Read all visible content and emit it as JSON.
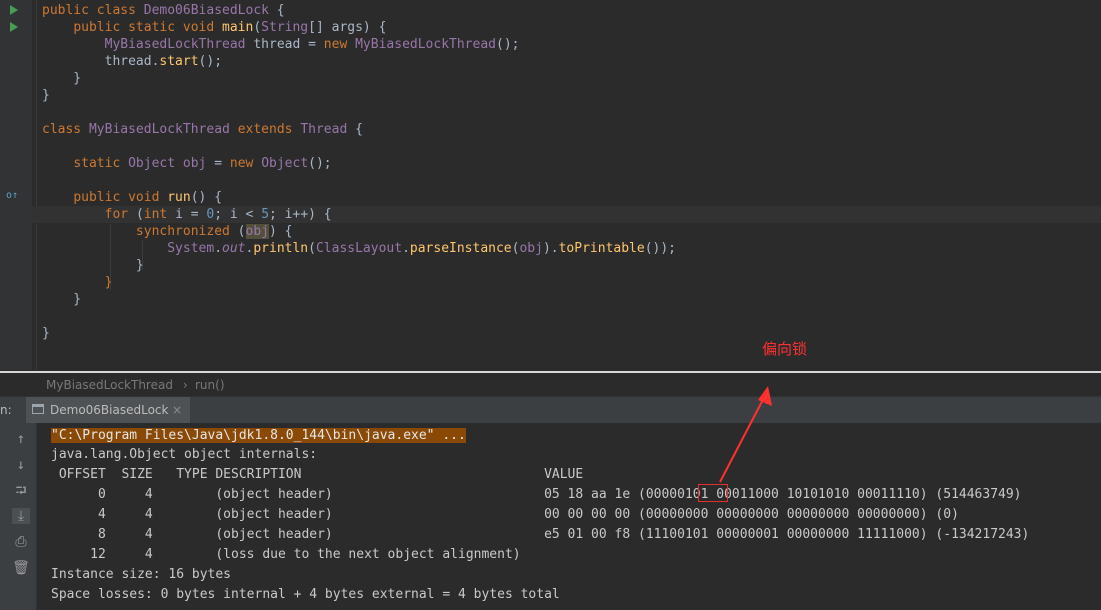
{
  "editor": {
    "lines": [
      "public class Demo06BiasedLock {",
      "    public static void main(String[] args) {",
      "        MyBiasedLockThread thread = new MyBiasedLockThread();",
      "        thread.start();",
      "    }",
      "}",
      "",
      "class MyBiasedLockThread extends Thread {",
      "",
      "    static Object obj = new Object();",
      "",
      "    public void run() {",
      "        for (int i = 0; i < 5; i++) {",
      "            synchronized (obj) {",
      "                System.out.println(ClassLayout.parseInstance(obj).toPrintable());",
      "            }",
      "        }",
      "    }",
      "",
      "}"
    ]
  },
  "breadcrumb": {
    "class_name": "MyBiasedLockThread",
    "separator": "›",
    "method": "run()"
  },
  "run_panel": {
    "label": "n:",
    "tab_label": "Demo06BiasedLock",
    "tab_close": "×",
    "icons": [
      "arrow-up-icon",
      "arrow-down-icon",
      "soft-wrap-icon",
      "scroll-to-end-icon",
      "print-icon",
      "trash-icon"
    ]
  },
  "console": {
    "command": "\"C:\\Program Files\\Java\\jdk1.8.0_144\\bin\\java.exe\" ...",
    "line1": "java.lang.Object object internals:",
    "header": " OFFSET  SIZE   TYPE DESCRIPTION                               VALUE",
    "rows": [
      "      0     4        (object header)                           05 18 aa 1e (00000101 00011000 10101010 00011110) (514463749)",
      "      4     4        (object header)                           00 00 00 00 (00000000 00000000 00000000 00000000) (0)",
      "      8     4        (object header)                           e5 01 00 f8 (11100101 00000001 00000000 11111000) (-134217243)",
      "     12     4        (loss due to the next object alignment)"
    ],
    "instance_size": "Instance size: 16 bytes",
    "space_losses": "Space losses: 0 bytes internal + 4 bytes external = 4 bytes total"
  },
  "annotation": {
    "text": "偏向锁",
    "color": "#ff3030"
  }
}
